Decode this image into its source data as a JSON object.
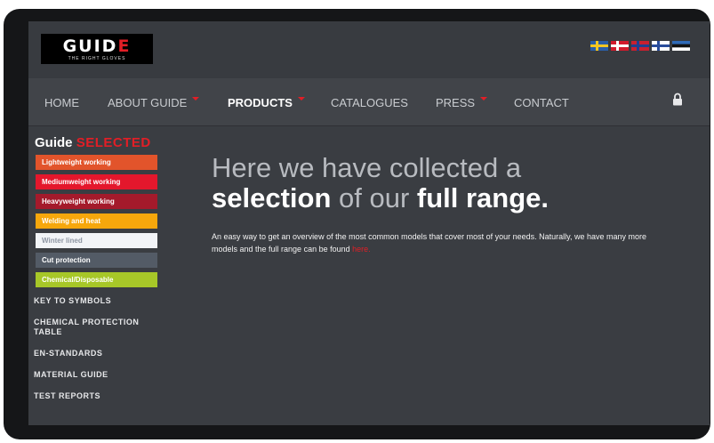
{
  "logo": {
    "word_left": "GUID",
    "word_right": "E",
    "tagline": "THE RIGHT GLOVES"
  },
  "flags": [
    {
      "name": "sweden-flag-icon",
      "base": "#2b5ea8",
      "cross": "#f3c623"
    },
    {
      "name": "denmark-flag-icon",
      "base": "#d21a2c",
      "cross": "#ffffff"
    },
    {
      "name": "norway-flag-icon",
      "base": "#c8202f",
      "cross": "#1f3f8f"
    },
    {
      "name": "finland-flag-icon",
      "base": "#ffffff",
      "cross": "#2a4d9b"
    },
    {
      "name": "estonia-flag-icon",
      "stripes": [
        "#2f6ab7",
        "#111111",
        "#ffffff"
      ]
    }
  ],
  "nav": {
    "items": [
      {
        "label": "HOME",
        "active": false,
        "dropdown": false
      },
      {
        "label": "ABOUT GUIDE",
        "active": false,
        "dropdown": true
      },
      {
        "label": "PRODUCTS",
        "active": true,
        "dropdown": true
      },
      {
        "label": "CATALOGUES",
        "active": false,
        "dropdown": false
      },
      {
        "label": "PRESS",
        "active": false,
        "dropdown": true
      },
      {
        "label": "CONTACT",
        "active": false,
        "dropdown": false
      }
    ],
    "lock_icon": "lock-icon"
  },
  "sidebar": {
    "title_main": "Guide",
    "title_accent": "SELECTED",
    "categories": [
      {
        "label": "Lightweight working",
        "color": "#e2542b",
        "text": "#ffffff"
      },
      {
        "label": "Mediumweight working",
        "color": "#e4172c",
        "text": "#ffffff"
      },
      {
        "label": "Heavyweight working",
        "color": "#a41a2b",
        "text": "#ffffff"
      },
      {
        "label": "Welding and heat",
        "color": "#f6a70c",
        "text": "#ffffff"
      },
      {
        "label": "Winter lined",
        "color": "#f2f4f7",
        "text": "#8e96a3"
      },
      {
        "label": "Cut protection",
        "color": "#535b66",
        "text": "#ffffff"
      },
      {
        "label": "Chemical/Disposable",
        "color": "#a7c728",
        "text": "#ffffff"
      }
    ],
    "links": [
      "KEY TO SYMBOLS",
      "CHEMICAL PROTECTION TABLE",
      "EN-STANDARDS",
      "MATERIAL GUIDE",
      "TEST REPORTS"
    ]
  },
  "main": {
    "headline_line1": "Here we have collected a",
    "headline_selection": "selection",
    "headline_of_our": " of our ",
    "headline_full_range": "full range.",
    "body_text": "An easy way to get an overview of the most common models that cover most of your needs. Naturally, we have many more models and the full range can be found ",
    "body_link": "here."
  }
}
